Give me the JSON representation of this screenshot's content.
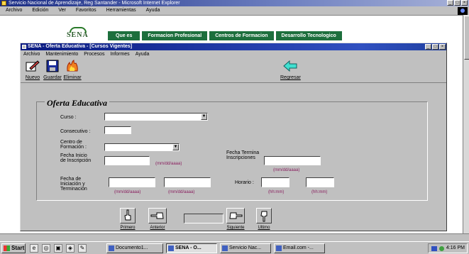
{
  "browser": {
    "title": "Servicio Nacional de Aprendizaje, Reg Santander - Microsoft Internet Explorer",
    "menu": [
      "Archivo",
      "Edición",
      "Ver",
      "Favoritos",
      "Herramientas",
      "Ayuda"
    ]
  },
  "site": {
    "logo": "SENA",
    "nav": [
      "Que es",
      "Formacion Profesional",
      "Centros de Formacion",
      "Desarrollo Tecnologico"
    ]
  },
  "app": {
    "title": "SENA - Oferta Educativa - [Cursos Vigentes]",
    "menu": [
      "Archivo",
      "Mantenimiento",
      "Procesos",
      "Informes",
      "Ayuda"
    ],
    "toolbar": {
      "nuevo": "Nuevo",
      "guardar": "Guardar",
      "eliminar": "Eliminar",
      "regresar": "Regresar"
    },
    "form": {
      "legend": "Oferta Educativa",
      "curso_label": "Curso :",
      "consecutivo_label": "Consecutivo :",
      "centro_label": "Centro de Formación :",
      "fecha_inicio_label": "Fecha Inicio de Inscripción",
      "fecha_termina_label": "Fecha Termina Inscripciones",
      "fecha_iniciacion_label": "Fecha de Iniciación y Terminación",
      "horario_label": "Horario :",
      "date_hint": "(mm/dd/aaaa)",
      "time_hint": "(hh:mm)"
    },
    "nav": {
      "primero": "Primero",
      "anterior": "Anterior",
      "siguiente": "Siguiente",
      "ultimo": "Ultimo"
    }
  },
  "taskbar": {
    "start": "Start",
    "tasks": [
      "Documento1...",
      "SENA - O...",
      "Servicio Nac...",
      "Email.com -..."
    ],
    "clock": "4:16 PM"
  }
}
